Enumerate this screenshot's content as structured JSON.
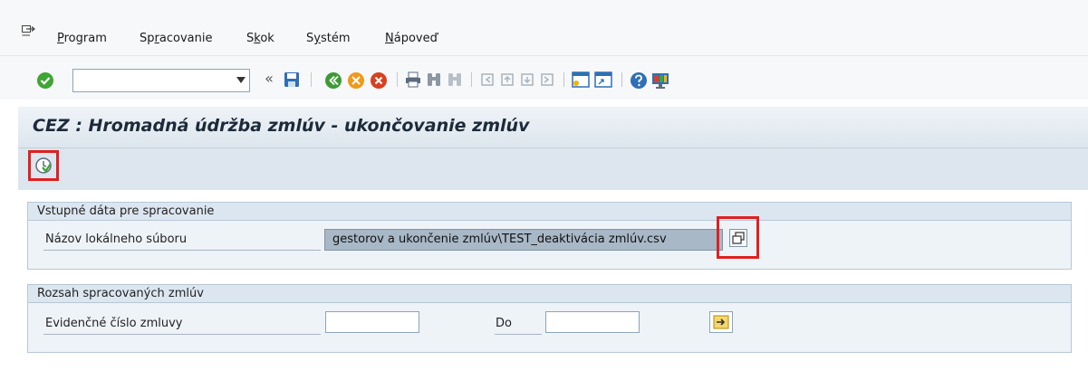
{
  "menu": {
    "items": [
      {
        "pre": "",
        "u": "P",
        "post": "rogram"
      },
      {
        "pre": "Sp",
        "u": "r",
        "post": "acovanie"
      },
      {
        "pre": "S",
        "u": "k",
        "post": "ok"
      },
      {
        "pre": "S",
        "u": "y",
        "post": "stém"
      },
      {
        "pre": "",
        "u": "N",
        "post": "ápoveď"
      }
    ]
  },
  "toolbar": {
    "command_value": "",
    "back_glyph": "«"
  },
  "page": {
    "title": "CEZ : Hromadná údržba zmlúv - ukončovanie zmlúv"
  },
  "input_group": {
    "header": "Vstupné dáta pre spracovanie",
    "file_label": "Názov lokálneho súboru",
    "file_value": "gestorov a ukončenie zmlúv\\TEST_deaktivácia zmlúv.csv"
  },
  "range_group": {
    "header": "Rozsah spracovaných zmlúv",
    "contract_label": "Evidenčné číslo zmluvy",
    "to_label": "Do",
    "from_value": "",
    "to_value": ""
  },
  "colors": {
    "highlight": "#e02020",
    "title_bg": "#dde6ee",
    "group_bg": "#eef3f8"
  }
}
